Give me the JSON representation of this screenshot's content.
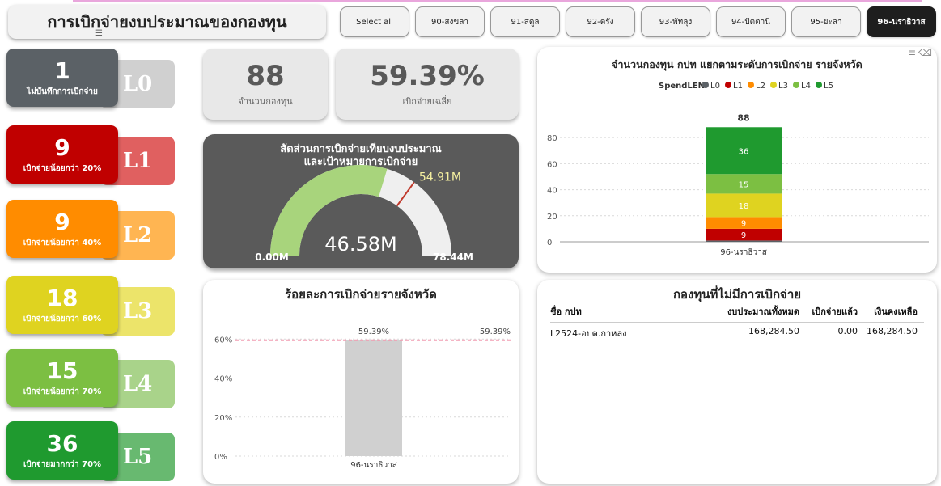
{
  "header": {
    "title": "การเบิกจ่ายงบประมาณของกองทุน"
  },
  "slicer": {
    "buttons": [
      "Select all",
      "90-สงขลา",
      "91-สตูล",
      "92-ตรัง",
      "93-พัทลุง",
      "94-ปัตตานี",
      "95-ยะลา",
      "96-นราธิวาส"
    ],
    "selected": "96-นราธิวาส"
  },
  "levels": [
    {
      "code": "L0",
      "count": "1",
      "caption": "ไม่บันทึกการเบิกจ่าย",
      "front_color": "#5b6166",
      "back_color": "#d0d0d0"
    },
    {
      "code": "L1",
      "count": "9",
      "caption": "เบิกจ่ายน้อยกว่า 20%",
      "front_color": "#c00000",
      "back_color": "#e06060"
    },
    {
      "code": "L2",
      "count": "9",
      "caption": "เบิกจ่ายน้อยกว่า 40%",
      "front_color": "#ff8c00",
      "back_color": "#ffb552"
    },
    {
      "code": "L3",
      "count": "18",
      "caption": "เบิกจ่ายน้อยกว่า 60%",
      "front_color": "#dfd320",
      "back_color": "#ece46a"
    },
    {
      "code": "L4",
      "count": "15",
      "caption": "เบิกจ่ายน้อยกว่า 70%",
      "front_color": "#7cbf42",
      "back_color": "#a9d38a"
    },
    {
      "code": "L5",
      "count": "36",
      "caption": "เบิกจ่ายมากกว่า 70%",
      "front_color": "#1f9a2f",
      "back_color": "#68b970"
    }
  ],
  "kpis": {
    "fund_count": {
      "value": "88",
      "label": "จำนวนกองทุน"
    },
    "avg_spend": {
      "value": "59.39%",
      "label": "เบิกจ่ายเฉลี่ย"
    }
  },
  "gauge": {
    "title_line1": "สัดส่วนการเบิกจ่ายเทียบงบประมาณ",
    "title_line2": "และเป้าหมายการเบิกจ่าย",
    "value": 46.58,
    "value_label": "46.58M",
    "min": 0,
    "min_label": "0.00M",
    "max": 78.44,
    "max_label": "78.44M",
    "target": 54.91,
    "target_label": "54.91M",
    "colors": {
      "fill": "#a8d47c",
      "track": "#efefef",
      "target": "#c0392b"
    }
  },
  "stacked_panel": {
    "title": "จำนวนกองทุน กปท แยกตามระดับการเบิกจ่าย รายจังหวัด",
    "legend_title": "SpendLEN"
  },
  "percent_panel": {
    "title": "ร้อยละการเบิกจ่ายรายจังหวัด"
  },
  "table_panel": {
    "title": "กองทุนที่ไม่มีการเบิกจ่าย",
    "columns": [
      "ชื่อ กปท",
      "งบประมาณทั้งหมด",
      "เบิกจ่ายแล้ว",
      "เงินคงเหลือ"
    ],
    "rows": [
      [
        "L2524-อบต.กาหลง",
        "168,284.50",
        "0.00",
        "168,284.50"
      ]
    ]
  },
  "chart_data": [
    {
      "type": "bar",
      "stacked": true,
      "title": "จำนวนกองทุน กปท แยกตามระดับการเบิกจ่าย รายจังหวัด",
      "categories": [
        "96-นราธิวาส"
      ],
      "series": [
        {
          "name": "L0",
          "values": [
            1
          ],
          "color": "#5b6166"
        },
        {
          "name": "L1",
          "values": [
            9
          ],
          "color": "#c00000"
        },
        {
          "name": "L2",
          "values": [
            9
          ],
          "color": "#ff8c00"
        },
        {
          "name": "L3",
          "values": [
            18
          ],
          "color": "#dfd320"
        },
        {
          "name": "L4",
          "values": [
            15
          ],
          "color": "#7cbf42"
        },
        {
          "name": "L5",
          "values": [
            36
          ],
          "color": "#1f9a2f"
        }
      ],
      "total_labels": [
        "88"
      ],
      "yticks": [
        0,
        20,
        40,
        60,
        80
      ],
      "ylim": [
        0,
        95
      ],
      "legend": "top",
      "grid": true
    },
    {
      "type": "bar",
      "title": "ร้อยละการเบิกจ่ายรายจังหวัด",
      "categories": [
        "96-นราธิวาส"
      ],
      "values": [
        59.39
      ],
      "value_labels": [
        "59.39%"
      ],
      "reference_line": {
        "value": 59.39,
        "label": "59.39%",
        "color": "#f29bb0"
      },
      "yticks": [
        "0%",
        "20%",
        "40%",
        "60%"
      ],
      "ylim": [
        0,
        68
      ],
      "bar_color": "#d0d0d0",
      "grid": true
    }
  ]
}
